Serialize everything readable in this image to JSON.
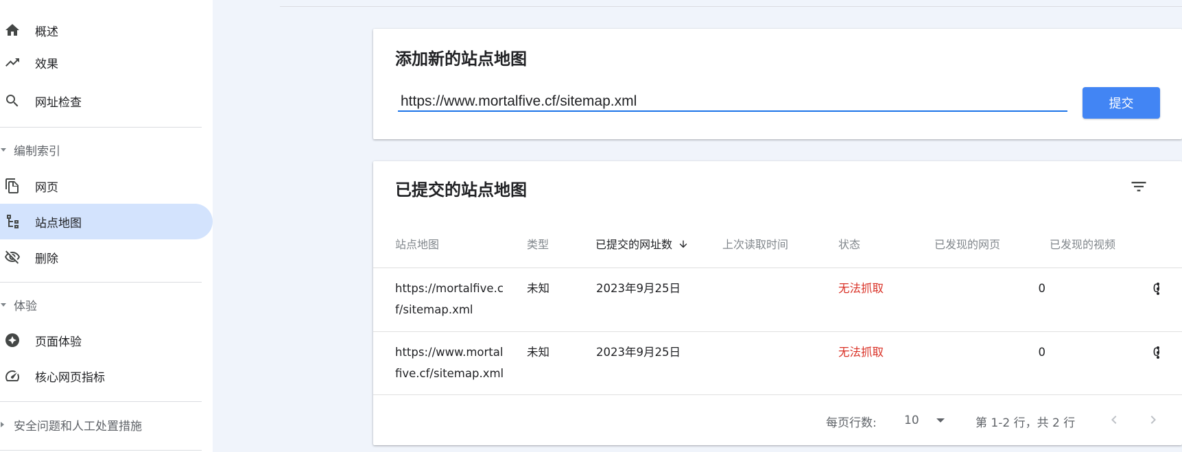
{
  "sidebar": {
    "items": [
      {
        "label": "概述",
        "icon": "home-icon"
      },
      {
        "label": "效果",
        "icon": "trending-up-icon"
      },
      {
        "label": "网址检查",
        "icon": "search-icon"
      }
    ],
    "sections": [
      {
        "label": "编制索引",
        "items": [
          {
            "label": "网页",
            "icon": "pages-copy-icon"
          },
          {
            "label": "站点地图",
            "icon": "sitemap-icon"
          },
          {
            "label": "删除",
            "icon": "visibility-off-icon"
          }
        ]
      },
      {
        "label": "体验",
        "items": [
          {
            "label": "页面体验",
            "icon": "page-experience-icon"
          },
          {
            "label": "核心网页指标",
            "icon": "speedometer-icon"
          }
        ]
      },
      {
        "label": "安全问题和人工处置措施",
        "items": []
      }
    ],
    "active_item": "站点地图"
  },
  "add_sitemap": {
    "title": "添加新的站点地图",
    "input_value": "https://www.mortalfive.cf/sitemap.xml",
    "submit_label": "提交"
  },
  "submitted": {
    "title": "已提交的站点地图",
    "columns": [
      "站点地图",
      "类型",
      "已提交的网址数",
      "上次读取时间",
      "状态",
      "已发现的网页",
      "已发现的视频"
    ],
    "rows": [
      {
        "sitemap_line1": "https://mortalfive.c",
        "sitemap_line2": "f/sitemap.xml",
        "type": "未知",
        "submitted": "2023年9月25日",
        "last_read": "",
        "status": "无法抓取",
        "pages": "0",
        "videos": "0"
      },
      {
        "sitemap_line1": "https://www.mortal",
        "sitemap_line2": "five.cf/sitemap.xml",
        "type": "未知",
        "submitted": "2023年9月25日",
        "last_read": "",
        "status": "无法抓取",
        "pages": "0",
        "videos": "0"
      }
    ],
    "footer": {
      "rows_per_page_label": "每页行数:",
      "rows_per_page_value": "10",
      "range_text": "第 1-2 行，共 2 行"
    }
  },
  "colors": {
    "accent": "#4285f4",
    "active_nav_bg": "#d3e3fd",
    "error": "#d93025"
  }
}
